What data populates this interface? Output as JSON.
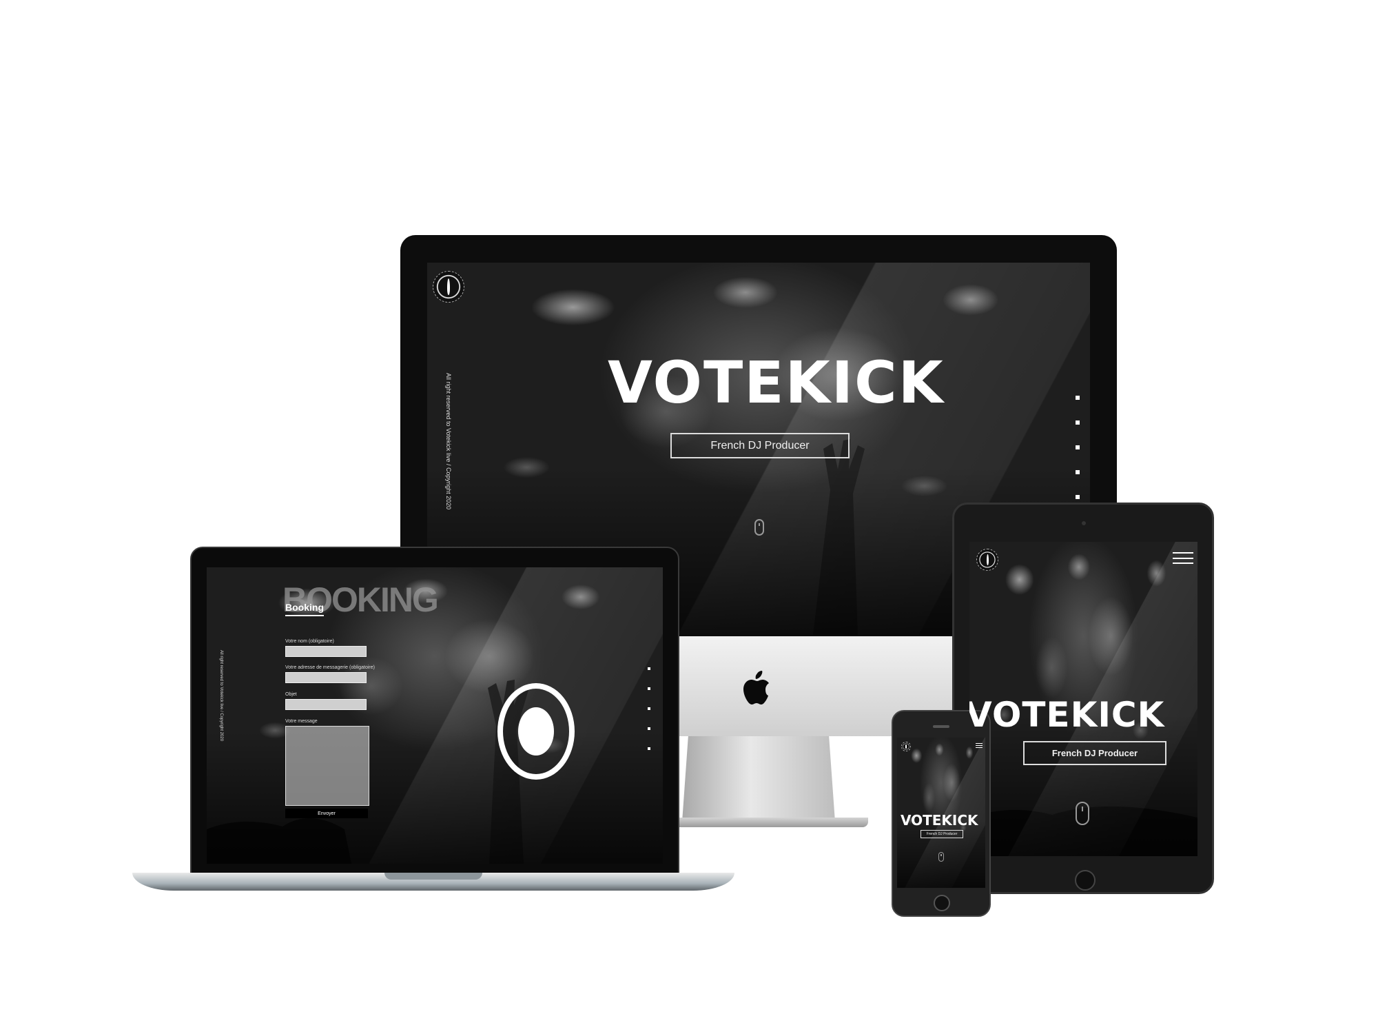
{
  "brand": {
    "name": "VOTEKICK",
    "tagline": "French DJ Producer",
    "copyright": "All right reserved to Votekick live / Copyright 2020"
  },
  "booking": {
    "watermark": "BOOKING",
    "title": "Booking",
    "fields": {
      "name_label": "Votre nom (obligatoire)",
      "email_label": "Votre adresse de messagerie (obligatoire)",
      "subject_label": "Objet",
      "message_label": "Votre message"
    },
    "submit_label": "Envoyer"
  },
  "nav": {
    "dots_desktop": 5,
    "dots_laptop": 5
  },
  "icons": {
    "logo": "votekick-eye-logo-icon",
    "scroll": "mouse-scroll-icon",
    "menu": "hamburger-menu-icon",
    "brand_mark": "apple-logo-icon"
  },
  "colors": {
    "background": "#ffffff",
    "screen": "#1c1c1c",
    "text": "#ffffff",
    "input": "#cfcfcf"
  }
}
